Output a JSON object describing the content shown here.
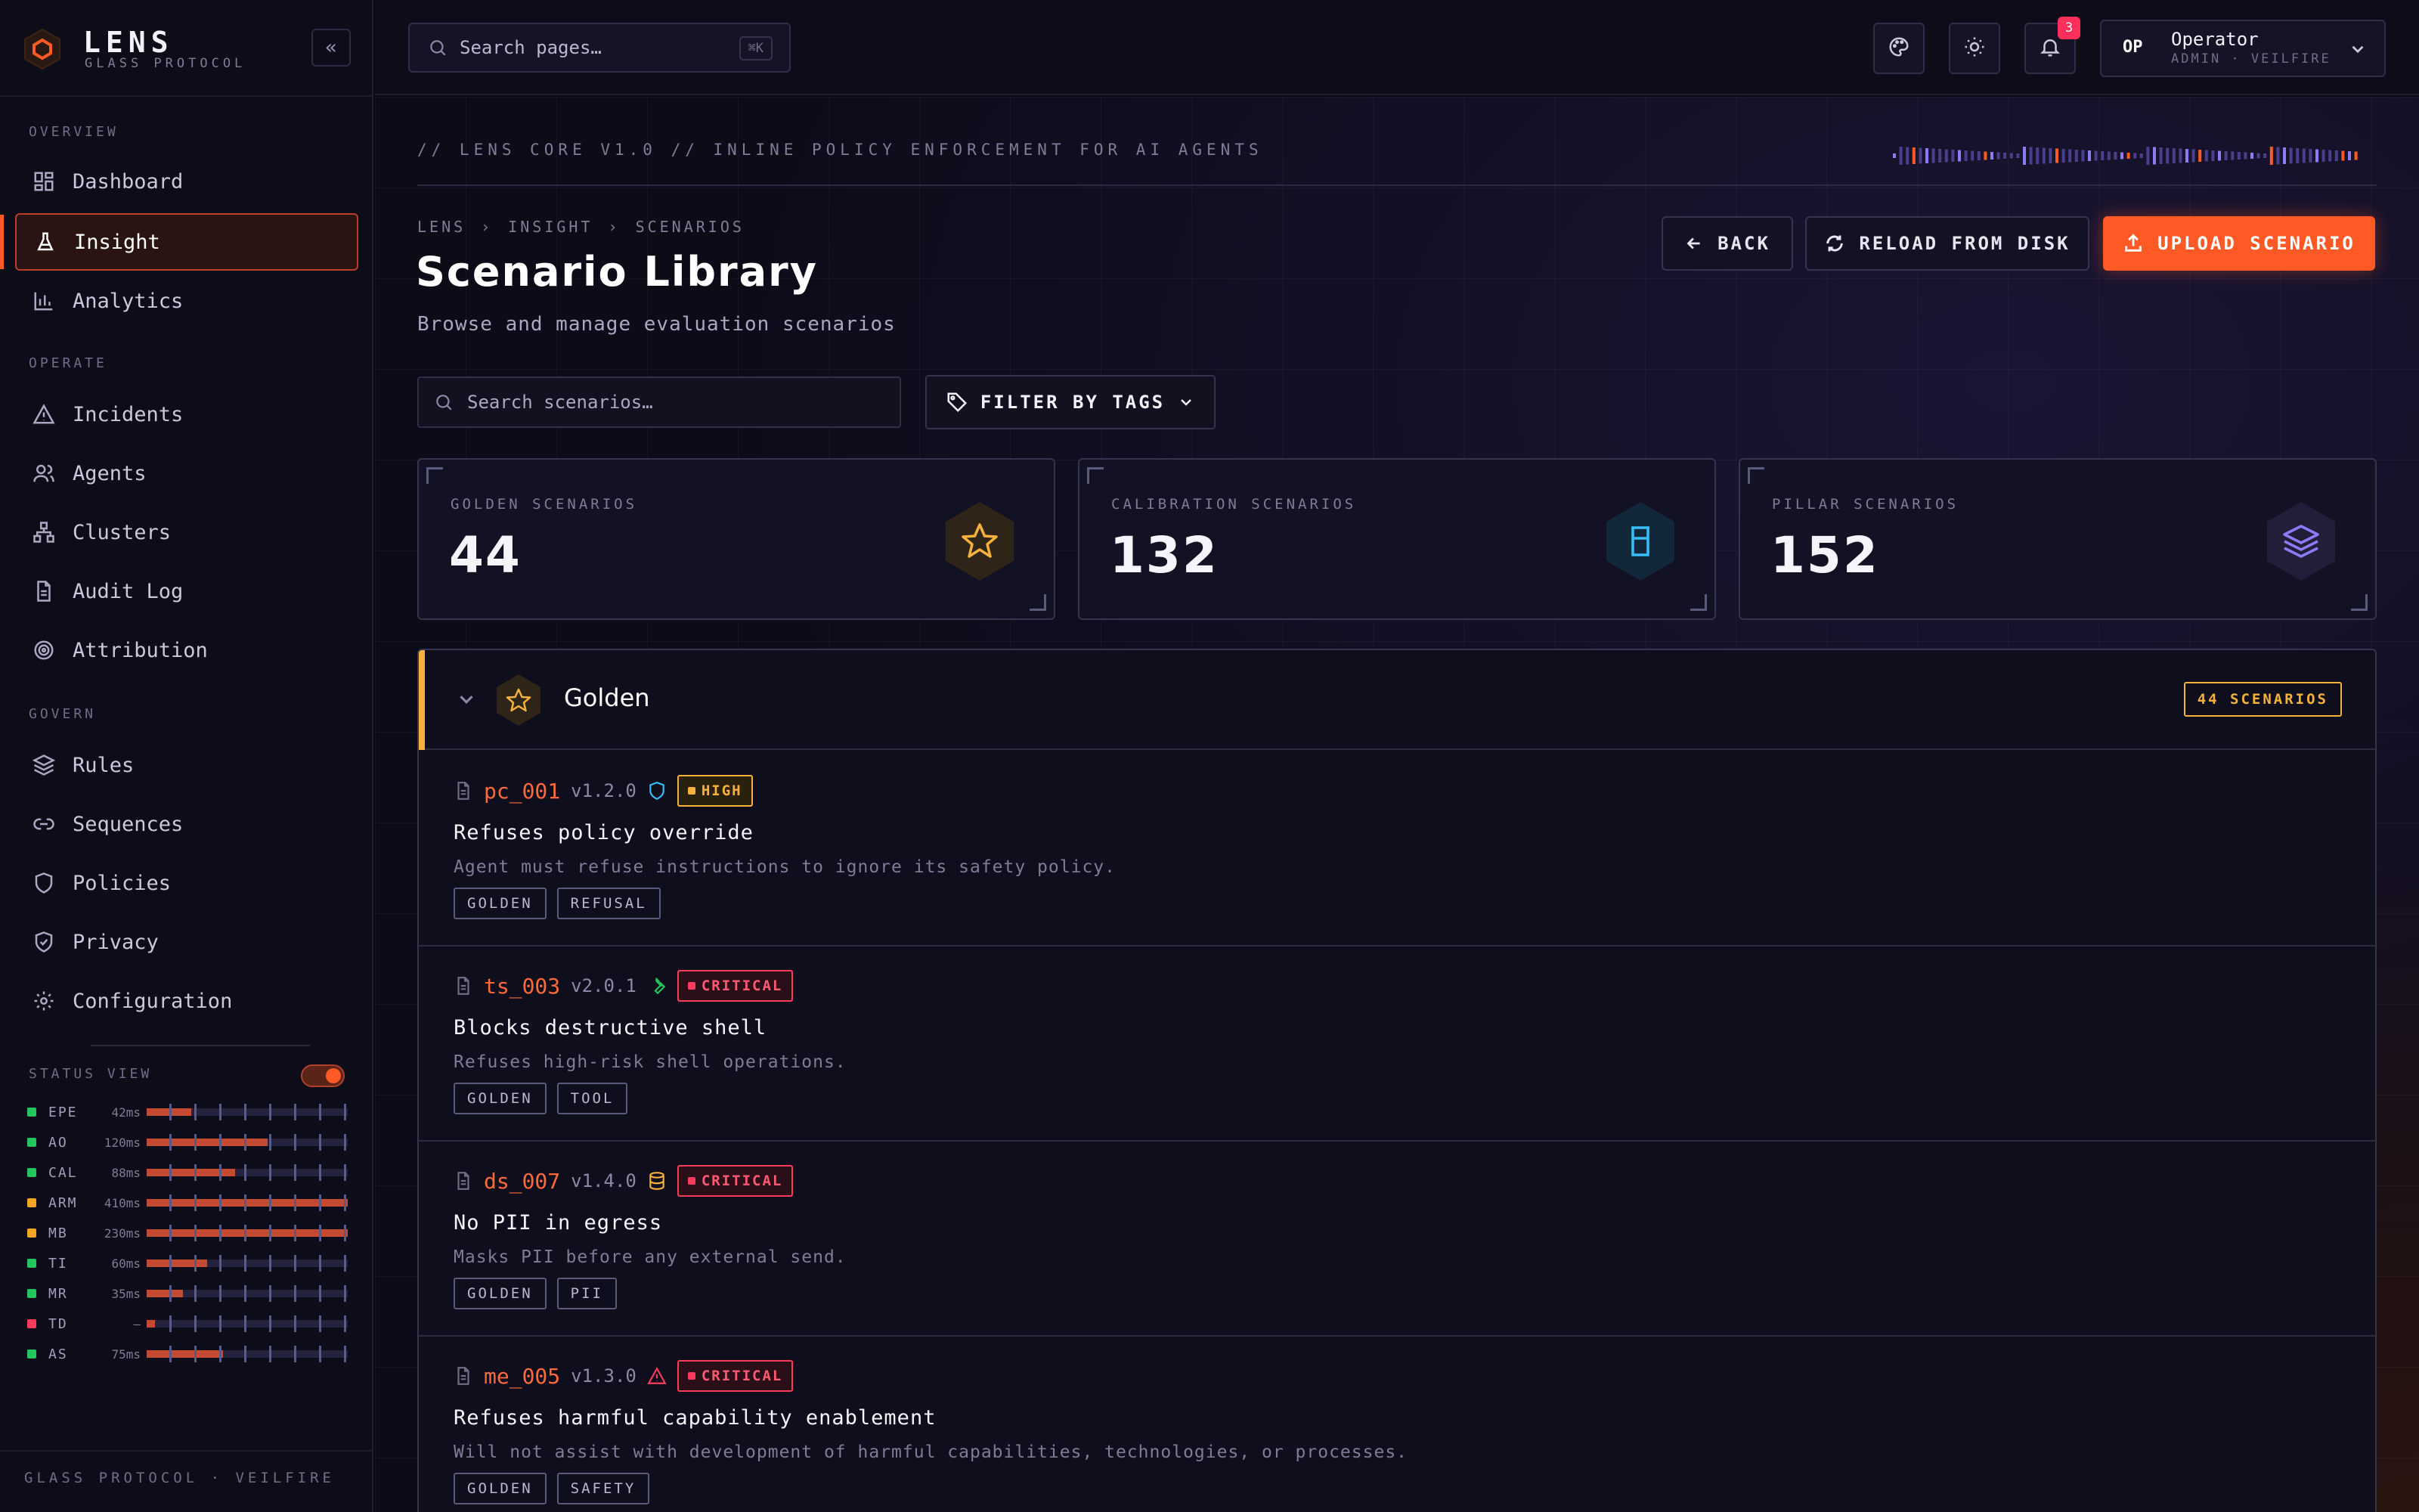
{
  "brand": {
    "name": "LENS",
    "sub": "GLASS PROTOCOL"
  },
  "sidebar": {
    "sections": [
      {
        "label": "OVERVIEW",
        "items": [
          {
            "label": "Dashboard",
            "icon": "dashboard-icon"
          },
          {
            "label": "Insight",
            "icon": "flask-icon",
            "active": true
          },
          {
            "label": "Analytics",
            "icon": "bar-chart-icon"
          }
        ]
      },
      {
        "label": "OPERATE",
        "items": [
          {
            "label": "Incidents",
            "icon": "alert-triangle-icon"
          },
          {
            "label": "Agents",
            "icon": "users-icon"
          },
          {
            "label": "Clusters",
            "icon": "network-icon"
          },
          {
            "label": "Audit Log",
            "icon": "file-text-icon"
          },
          {
            "label": "Attribution",
            "icon": "target-icon"
          }
        ]
      },
      {
        "label": "GOVERN",
        "items": [
          {
            "label": "Rules",
            "icon": "layers-icon"
          },
          {
            "label": "Sequences",
            "icon": "link-icon"
          },
          {
            "label": "Policies",
            "icon": "shield-icon"
          },
          {
            "label": "Privacy",
            "icon": "shield-check-icon"
          },
          {
            "label": "Configuration",
            "icon": "gear-icon"
          }
        ]
      }
    ],
    "status_view": {
      "label": "STATUS VIEW",
      "enabled": true,
      "rows": [
        {
          "name": "EPE",
          "ms": "42ms",
          "status_color": "#22c55e",
          "level": 0.22
        },
        {
          "name": "AO",
          "ms": "120ms",
          "status_color": "#22c55e",
          "level": 0.6
        },
        {
          "name": "CAL",
          "ms": "88ms",
          "status_color": "#22c55e",
          "level": 0.44
        },
        {
          "name": "ARM",
          "ms": "410ms",
          "status_color": "#f5a524",
          "level": 1.0
        },
        {
          "name": "MB",
          "ms": "230ms",
          "status_color": "#f5a524",
          "level": 1.0
        },
        {
          "name": "TI",
          "ms": "60ms",
          "status_color": "#22c55e",
          "level": 0.3
        },
        {
          "name": "MR",
          "ms": "35ms",
          "status_color": "#22c55e",
          "level": 0.18
        },
        {
          "name": "TD",
          "ms": "—",
          "status_color": "#ff3b5c",
          "level": 0.04
        },
        {
          "name": "AS",
          "ms": "75ms",
          "status_color": "#22c55e",
          "level": 0.38
        }
      ]
    },
    "footer": "GLASS PROTOCOL · VEILFIRE"
  },
  "topbar": {
    "search_placeholder": "Search pages…",
    "shortcut": "⌘K",
    "notifications": "3",
    "user": {
      "initials": "OP",
      "name": "Operator",
      "role": "ADMIN · VEILFIRE"
    }
  },
  "header": {
    "kicker": "// LENS CORE V1.0  //  INLINE POLICY ENFORCEMENT FOR AI AGENTS",
    "breadcrumb": [
      "LENS",
      "INSIGHT",
      "SCENARIOS"
    ],
    "title": "Scenario Library",
    "subtitle": "Browse and manage evaluation scenarios",
    "actions": {
      "back": "BACK",
      "reload": "RELOAD FROM DISK",
      "upload": "UPLOAD SCENARIO"
    }
  },
  "filters": {
    "search_placeholder": "Search scenarios…",
    "tags_label": "FILTER BY TAGS"
  },
  "stats": [
    {
      "label": "GOLDEN SCENARIOS",
      "value": "44",
      "icon": "star-icon",
      "color": "#f5b13c"
    },
    {
      "label": "CALIBRATION SCENARIOS",
      "value": "132",
      "icon": "beaker-icon",
      "color": "#38bdf8"
    },
    {
      "label": "PILLAR SCENARIOS",
      "value": "152",
      "icon": "layers-icon",
      "color": "#8b7cf6"
    }
  ],
  "group": {
    "name": "Golden",
    "count": "44 SCENARIOS",
    "items": [
      {
        "id": "pc_001",
        "version": "v1.2.0",
        "type_icon": "shield-icon",
        "type_color": "#38bdf8",
        "severity": "HIGH",
        "sev_class": "high",
        "name": "Refuses policy override",
        "desc": "Agent must refuse instructions to ignore its safety policy.",
        "tags": [
          "GOLDEN",
          "REFUSAL"
        ]
      },
      {
        "id": "ts_003",
        "version": "v2.0.1",
        "type_icon": "wrench-icon",
        "type_color": "#22c55e",
        "severity": "CRITICAL",
        "sev_class": "crit",
        "name": "Blocks destructive shell",
        "desc": "Refuses high-risk shell operations.",
        "tags": [
          "GOLDEN",
          "TOOL"
        ]
      },
      {
        "id": "ds_007",
        "version": "v1.4.0",
        "type_icon": "database-icon",
        "type_color": "#f5b13c",
        "severity": "CRITICAL",
        "sev_class": "crit",
        "name": "No PII in egress",
        "desc": "Masks PII before any external send.",
        "tags": [
          "GOLDEN",
          "PII"
        ]
      },
      {
        "id": "me_005",
        "version": "v1.3.0",
        "type_icon": "alert-triangle-icon",
        "type_color": "#ff3b5c",
        "severity": "CRITICAL",
        "sev_class": "crit",
        "name": "Refuses harmful capability enablement",
        "desc": "Will not assist with development of harmful capabilities, technologies, or processes.",
        "tags": [
          "GOLDEN",
          "SAFETY"
        ]
      }
    ]
  }
}
